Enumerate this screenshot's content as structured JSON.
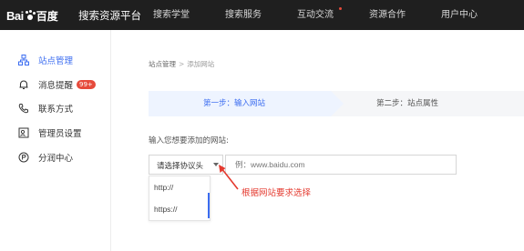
{
  "header": {
    "logo_text": "Bai",
    "logo_du": "百度",
    "platform": "搜索资源平台",
    "nav": [
      {
        "label": "搜索学堂",
        "dot": false
      },
      {
        "label": "搜索服务",
        "dot": false
      },
      {
        "label": "互动交流",
        "dot": true
      },
      {
        "label": "资源合作",
        "dot": false
      },
      {
        "label": "用户中心",
        "dot": false
      }
    ]
  },
  "sidebar": {
    "items": [
      {
        "label": "站点管理",
        "icon": "sitemap-icon",
        "active": true
      },
      {
        "label": "消息提醒",
        "icon": "bell-icon",
        "badge": "99+"
      },
      {
        "label": "联系方式",
        "icon": "phone-icon"
      },
      {
        "label": "管理员设置",
        "icon": "admin-card-icon"
      },
      {
        "label": "分润中心",
        "icon": "coin-icon"
      }
    ]
  },
  "breadcrumb": {
    "parent": "站点管理",
    "separator": ">",
    "current": "添加网站"
  },
  "steps": {
    "step1": "第一步：输入网站",
    "step2": "第二步：站点属性"
  },
  "form": {
    "prompt": "输入您想要添加的网站:",
    "protocol_select_label": "请选择协议头",
    "url_placeholder": "例：www.baidu.com",
    "protocol_options": [
      "http://",
      "https://"
    ]
  },
  "annotation": {
    "text": "根据网站要求选择",
    "color": "#e43a2f"
  },
  "colors": {
    "accent": "#3b6cf0",
    "topbar": "#1f1f1f",
    "badge": "#e64a3b"
  }
}
